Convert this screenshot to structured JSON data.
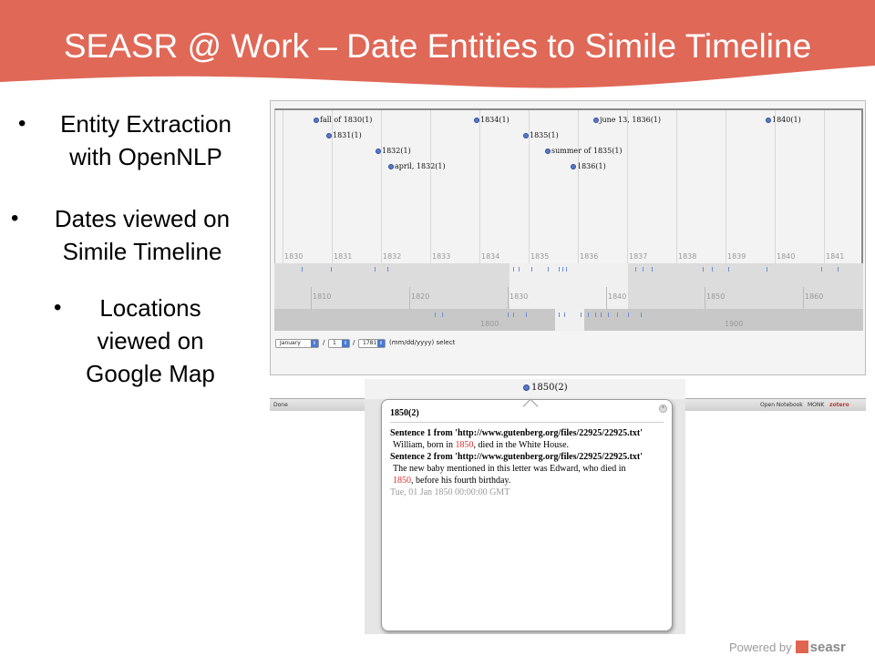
{
  "slide": {
    "title": "SEASR @ Work – Date Entities to Simile Timeline",
    "banner_color": "#e06857",
    "bullets": [
      {
        "lines": [
          "Entity Extraction",
          "with OpenNLP"
        ]
      },
      {
        "lines": [
          "Dates viewed on",
          "Simile Timeline"
        ]
      },
      {
        "lines": [
          "Locations",
          "viewed on",
          "Google Map"
        ]
      }
    ]
  },
  "timeline": {
    "events": [
      "fall of 1830(1)",
      "1831(1)",
      "1832(1)",
      "april, 1832(1)",
      "1834(1)",
      "1835(1)",
      "summer of 1835(1)",
      "1836(1)",
      "june 13, 1836(1)",
      "1840(1)"
    ],
    "years_top": [
      "1830",
      "1831",
      "1832",
      "1833",
      "1834",
      "1835",
      "1836",
      "1837",
      "1838",
      "1839",
      "1840",
      "1841"
    ],
    "years_mid": [
      "1810",
      "1820",
      "1830",
      "1840",
      "1850",
      "1860"
    ],
    "years_bottom": [
      "1800",
      "1900"
    ],
    "controls": {
      "month": "January",
      "day": "1",
      "year": "1781",
      "format_label": "(mm/dd/yyyy) select",
      "sep1": "/",
      "sep2": "/"
    },
    "event_color": "#5a79c8"
  },
  "statusbar": {
    "left": "Done",
    "open_notebook": "Open Notebook",
    "monk": "MONK",
    "zotero": "zotero"
  },
  "popup": {
    "marker": "1850(2)",
    "heading": "1850(2)",
    "sentence1_title": "Sentence 1 from 'http://www.gutenberg.org/files/22925/22925.txt'",
    "sentence1_pre": "William, born in ",
    "sentence1_hl": "1850",
    "sentence1_post": ", died in the White House.",
    "sentence2_title": "Sentence 2 from 'http://www.gutenberg.org/files/22925/22925.txt'",
    "sentence2_pre": "The new baby mentioned in this letter was Edward, who died in",
    "sentence2_hl": "1850",
    "sentence2_post": ", before his fourth birthday.",
    "datetime": "Tue, 01 Jan 1850 00:00:00 GMT",
    "highlight_color": "#d9312b"
  },
  "footer": {
    "powered": "Powered by",
    "brand": "seasr"
  }
}
